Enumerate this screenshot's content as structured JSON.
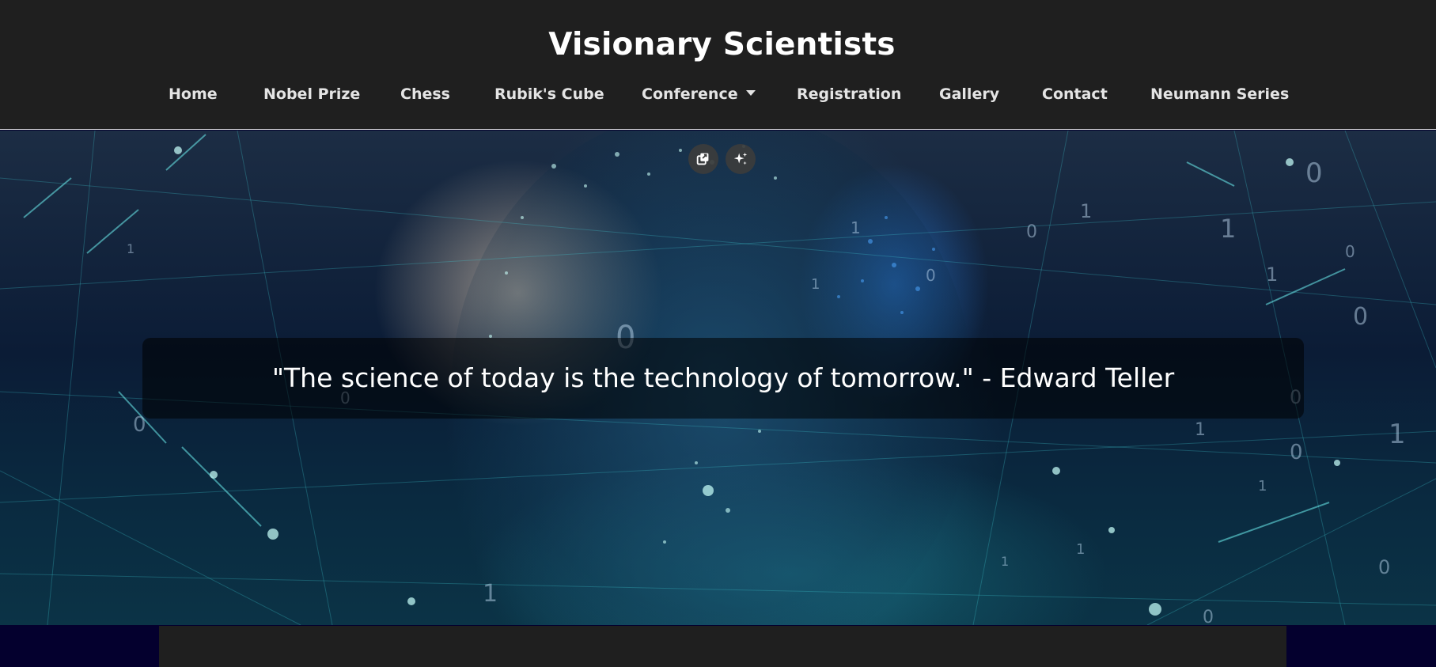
{
  "site": {
    "title": "Visionary Scientists"
  },
  "nav": {
    "items": [
      {
        "label": "Home"
      },
      {
        "label": "Nobel Prize"
      },
      {
        "label": "Chess"
      },
      {
        "label": "Rubik's Cube"
      },
      {
        "label": "Conference",
        "has_dropdown": true
      },
      {
        "label": "Registration"
      },
      {
        "label": "Gallery"
      },
      {
        "label": "Contact"
      },
      {
        "label": "Neumann Series"
      }
    ]
  },
  "hero": {
    "quote": "\"The science of today is the technology of tomorrow.\" - Edward Teller",
    "tools": [
      {
        "icon": "copy-image-icon"
      },
      {
        "icon": "sparkle-icon"
      }
    ],
    "digits": [
      "0",
      "1",
      "1",
      "0",
      "1",
      "0",
      "1",
      "0",
      "1",
      "0",
      "1",
      "0",
      "1",
      "0",
      "1",
      "0",
      "0",
      "1",
      "0",
      "1",
      "1",
      "0",
      "1",
      "0"
    ]
  },
  "colors": {
    "header_bg": "#1f1f1f",
    "page_bg": "#04002e",
    "nav_text": "#e4e4e4",
    "quote_box": "rgba(0,0,0,0.55)"
  }
}
